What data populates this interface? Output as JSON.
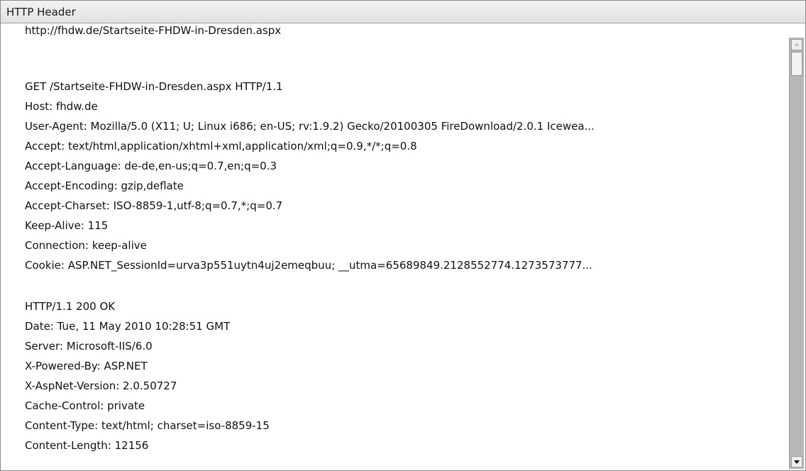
{
  "panel": {
    "title": "HTTP Header"
  },
  "lines": [
    "http://fhdw.de/Startseite-FHDW-in-Dresden.aspx",
    "",
    "GET /Startseite-FHDW-in-Dresden.aspx HTTP/1.1",
    "Host: fhdw.de",
    "User-Agent: Mozilla/5.0 (X11; U; Linux i686; en-US; rv:1.9.2) Gecko/20100305 FireDownload/2.0.1 Icewea...",
    "Accept: text/html,application/xhtml+xml,application/xml;q=0.9,*/*;q=0.8",
    "Accept-Language: de-de,en-us;q=0.7,en;q=0.3",
    "Accept-Encoding: gzip,deflate",
    "Accept-Charset: ISO-8859-1,utf-8;q=0.7,*;q=0.7",
    "Keep-Alive: 115",
    "Connection: keep-alive",
    "Cookie: ASP.NET_SessionId=urva3p551uytn4uj2emeqbuu; __utma=65689849.2128552774.1273573777...",
    "",
    "HTTP/1.1 200 OK",
    "Date: Tue, 11 May 2010 10:28:51 GMT",
    "Server: Microsoft-IIS/6.0",
    "X-Powered-By: ASP.NET",
    "X-AspNet-Version: 2.0.50727",
    "Cache-Control: private",
    "Content-Type: text/html; charset=iso-8859-15",
    "Content-Length: 12156"
  ]
}
